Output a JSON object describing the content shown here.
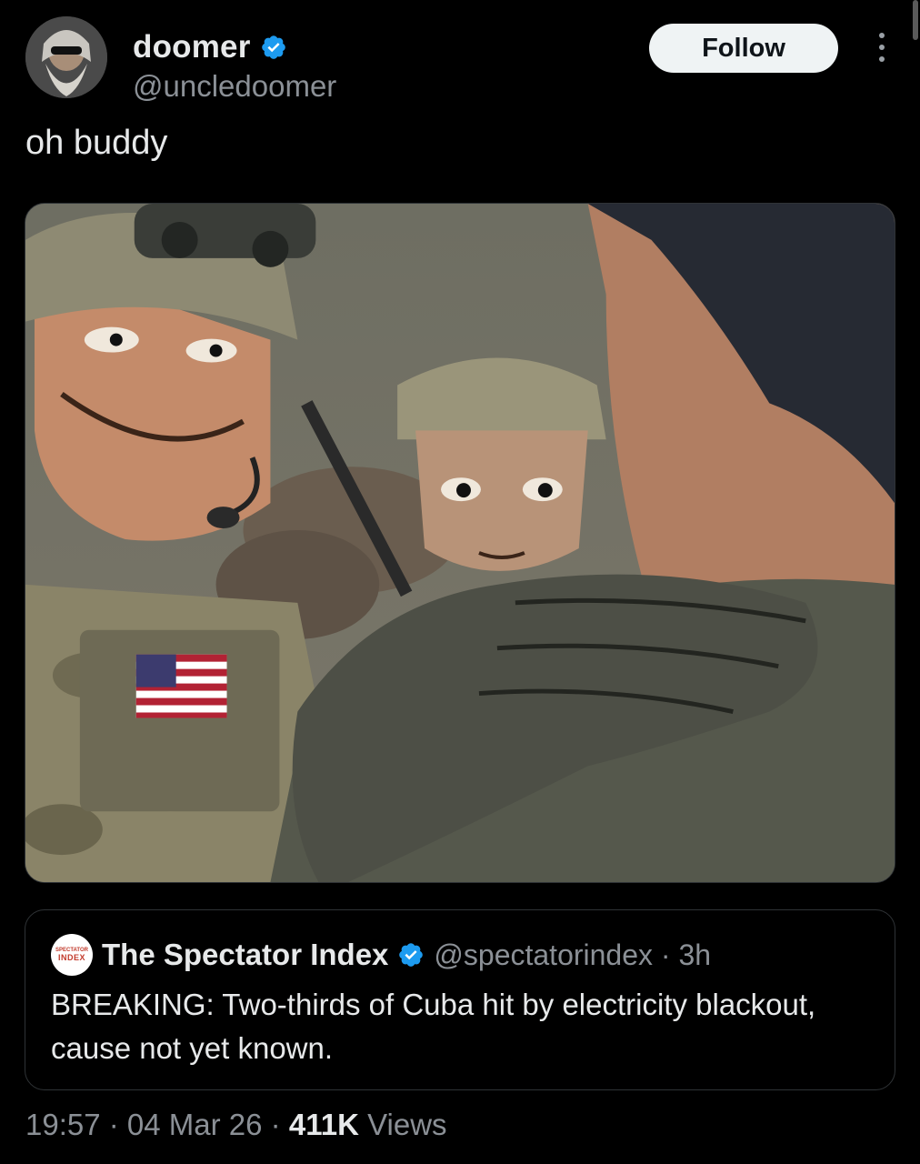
{
  "author": {
    "display_name": "doomer",
    "handle": "@uncledoomer",
    "verified_color": "#1d9bf0"
  },
  "actions": {
    "follow_label": "Follow",
    "more_icon": "more-vertical-icon"
  },
  "tweet": {
    "text": "oh buddy"
  },
  "quoted": {
    "display_name": "The Spectator Index",
    "handle": "@spectatorindex",
    "separator": " · ",
    "age": "3h",
    "text": "BREAKING: Two-thirds of Cuba hit by electricity blackout, cause not yet known.",
    "avatar_logo_line1": "SPECTATOR",
    "avatar_logo_line2": "INDEX"
  },
  "meta": {
    "time": "19:57",
    "sep1": " · ",
    "date": "04 Mar 26",
    "sep2": " · ",
    "views_count": "411K",
    "views_label": " Views"
  },
  "colors": {
    "background": "#000000",
    "text_primary": "#e7e9ea",
    "text_secondary": "#8b9096",
    "border": "#2f3336",
    "follow_bg": "#eff3f4"
  }
}
